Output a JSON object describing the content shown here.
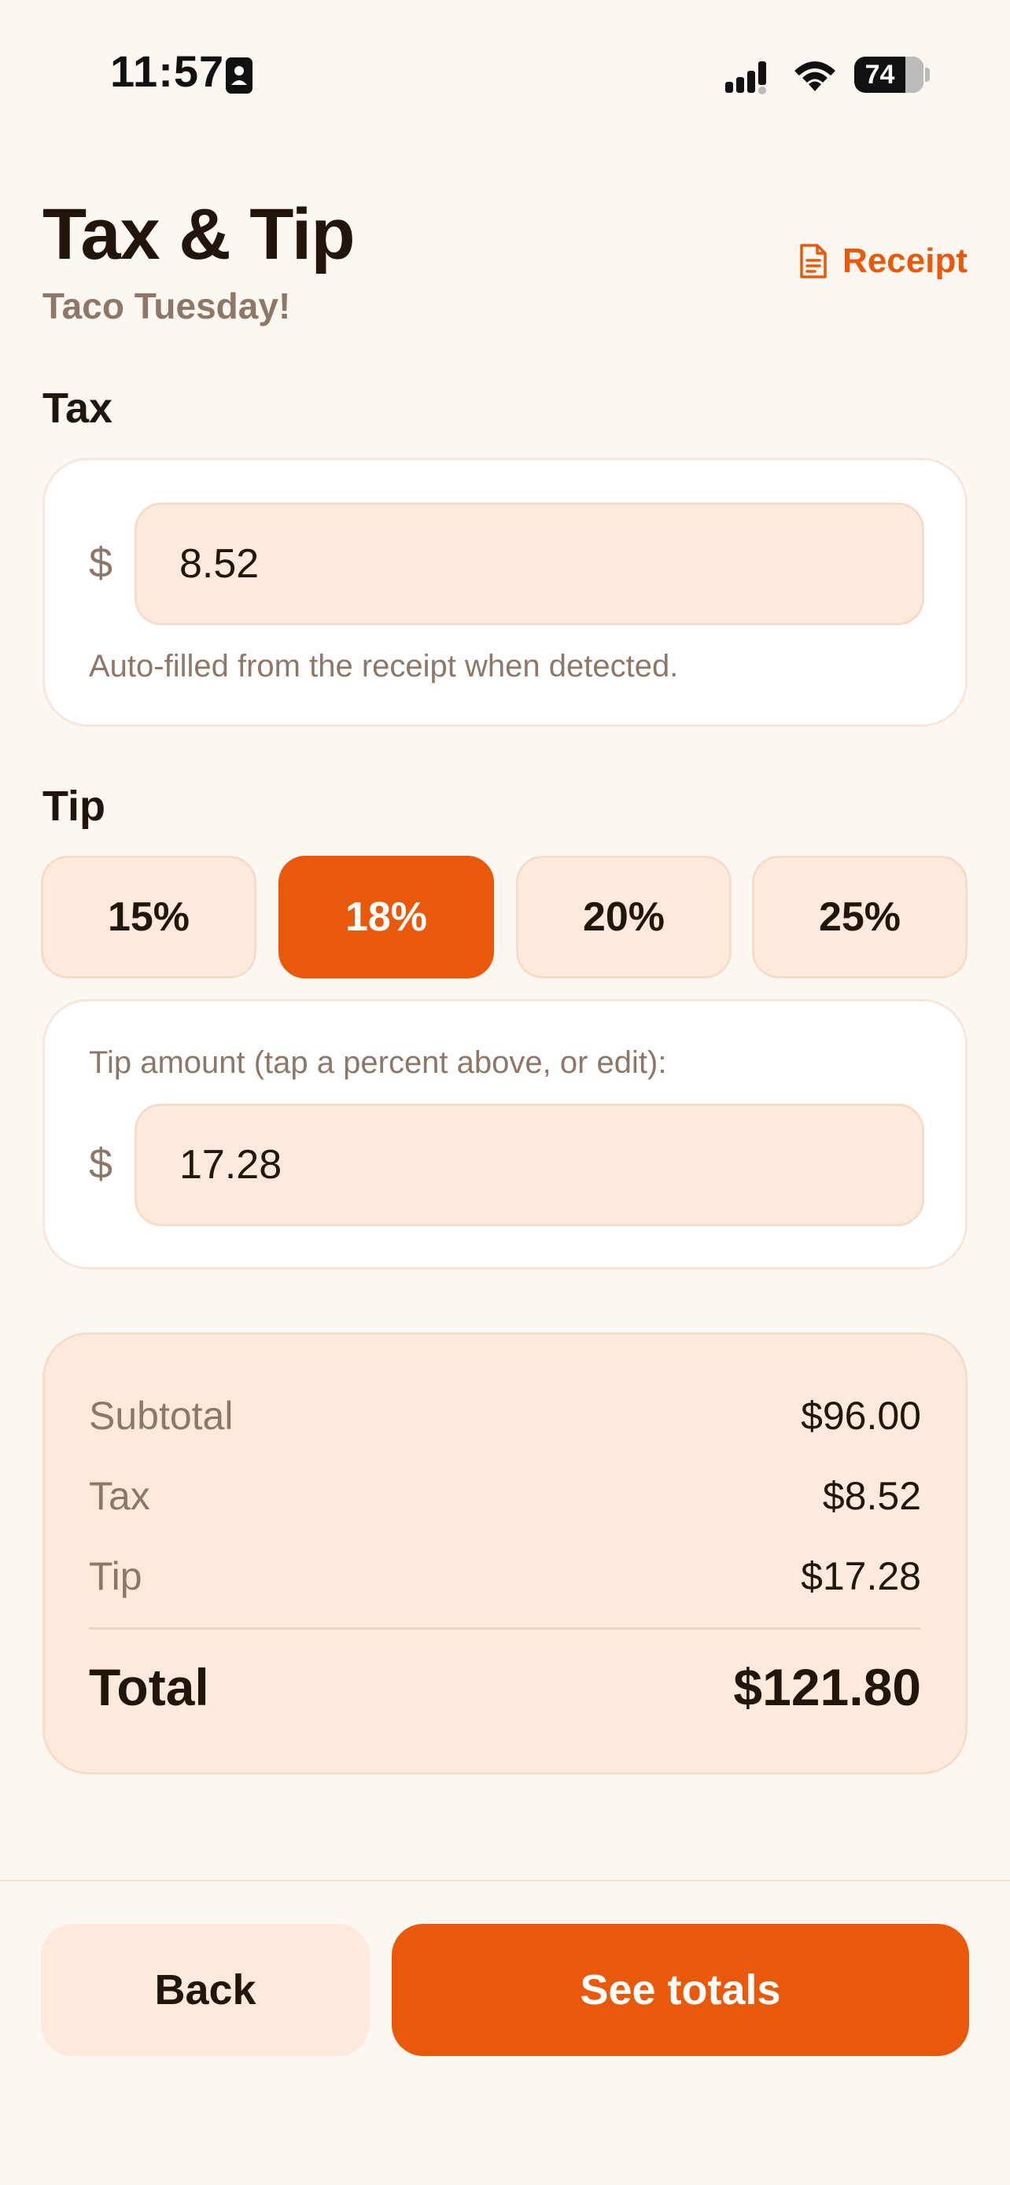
{
  "status_bar": {
    "time": "11:57",
    "battery": "74",
    "battery_level": 0.74
  },
  "header": {
    "title": "Tax & Tip",
    "subtitle": "Taco Tuesday!",
    "receipt_label": "Receipt",
    "receipt_icon": "document-icon"
  },
  "tax": {
    "section_label": "Tax",
    "currency": "$",
    "value": "8.52",
    "hint": "Auto-filled from the receipt when detected."
  },
  "tip": {
    "section_label": "Tip",
    "options": [
      {
        "label": "15%",
        "selected": false
      },
      {
        "label": "18%",
        "selected": true
      },
      {
        "label": "20%",
        "selected": false
      },
      {
        "label": "25%",
        "selected": false
      }
    ],
    "amount_hint": "Tip amount (tap a percent above, or edit):",
    "currency": "$",
    "value": "17.28"
  },
  "summary": {
    "rows": [
      {
        "label": "Subtotal",
        "value": "$96.00"
      },
      {
        "label": "Tax",
        "value": "$8.52"
      },
      {
        "label": "Tip",
        "value": "$17.28"
      }
    ],
    "total_label": "Total",
    "total_value": "$121.80"
  },
  "footer": {
    "back_label": "Back",
    "primary_label": "See totals"
  },
  "colors": {
    "accent": "#e8590c",
    "background": "#fdf7f2",
    "field_fill": "#feeadc",
    "muted_text": "#8e7766"
  }
}
